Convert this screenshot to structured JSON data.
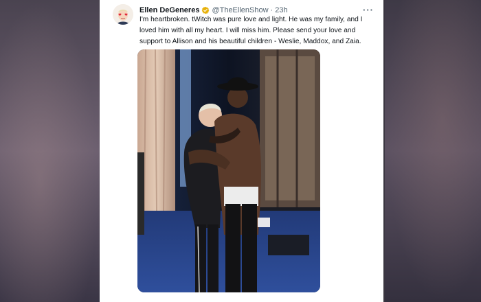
{
  "tweet": {
    "author_name": "Ellen DeGeneres",
    "handle": "@TheEllenShow",
    "separator": "·",
    "timestamp": "23h",
    "more_icon": "more-horizontal-icon",
    "verified_icon": "verified-badge-icon",
    "text": "I'm heartbroken. tWitch was pure love and light. He was my family, and I loved him with all my heart. I will miss him. Please send your love and support to Allison and his beautiful children - Weslie, Maddox, and Zaia."
  },
  "colors": {
    "verified_badge": "#e7b10a",
    "text_primary": "#0f1419",
    "text_secondary": "#536471",
    "card_background": "#ffffff"
  }
}
